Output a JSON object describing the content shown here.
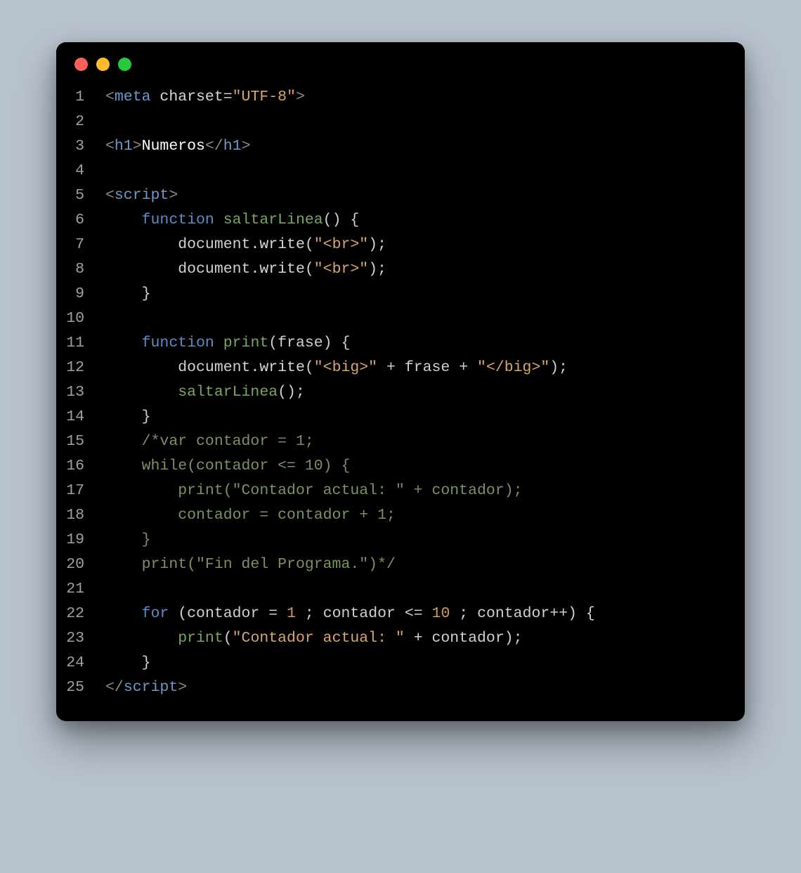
{
  "window": {
    "traffic_lights": [
      "close",
      "minimize",
      "maximize"
    ]
  },
  "colors": {
    "background_page": "#b9c3cf",
    "window_bg": "#000000",
    "red": "#ff5f56",
    "yellow": "#ffbd2e",
    "green": "#27c93f"
  },
  "syntax_colors": {
    "angle_bracket": "#8a8a8a",
    "tag": "#6b9acb",
    "attribute": "#d6d6d6",
    "string": "#d8a768",
    "text": "#ffffff",
    "keyword": "#5b8cc5",
    "function": "#7aa65f",
    "identifier": "#d0d0d0",
    "punctuation": "#d0d0d0",
    "number": "#d19a5e",
    "comment": "#7a9260"
  },
  "code": {
    "lines": [
      {
        "n": 1,
        "tokens": [
          [
            "angle",
            "<"
          ],
          [
            "tag",
            "meta"
          ],
          [
            "text",
            " "
          ],
          [
            "attr",
            "charset"
          ],
          [
            "punc",
            "="
          ],
          [
            "string",
            "\"UTF-8\""
          ],
          [
            "angle",
            ">"
          ]
        ]
      },
      {
        "n": 2,
        "tokens": []
      },
      {
        "n": 3,
        "tokens": [
          [
            "angle",
            "<"
          ],
          [
            "tag",
            "h1"
          ],
          [
            "angle",
            ">"
          ],
          [
            "txt",
            "Numeros"
          ],
          [
            "angle",
            "</"
          ],
          [
            "tag",
            "h1"
          ],
          [
            "angle",
            ">"
          ]
        ]
      },
      {
        "n": 4,
        "tokens": []
      },
      {
        "n": 5,
        "tokens": [
          [
            "angle",
            "<"
          ],
          [
            "tag",
            "script"
          ],
          [
            "angle",
            ">"
          ]
        ]
      },
      {
        "n": 6,
        "tokens": [
          [
            "ws",
            "    "
          ],
          [
            "keyword",
            "function"
          ],
          [
            "text",
            " "
          ],
          [
            "fn",
            "saltarLinea"
          ],
          [
            "punc",
            "()"
          ],
          [
            "text",
            " "
          ],
          [
            "punc",
            "{"
          ]
        ]
      },
      {
        "n": 7,
        "tokens": [
          [
            "ws",
            "        "
          ],
          [
            "ident",
            "document"
          ],
          [
            "punc",
            "."
          ],
          [
            "method",
            "write"
          ],
          [
            "punc",
            "("
          ],
          [
            "string",
            "\"<br>\""
          ],
          [
            "punc",
            ");"
          ]
        ]
      },
      {
        "n": 8,
        "tokens": [
          [
            "ws",
            "        "
          ],
          [
            "ident",
            "document"
          ],
          [
            "punc",
            "."
          ],
          [
            "method",
            "write"
          ],
          [
            "punc",
            "("
          ],
          [
            "string",
            "\"<br>\""
          ],
          [
            "punc",
            ");"
          ]
        ]
      },
      {
        "n": 9,
        "tokens": [
          [
            "ws",
            "    "
          ],
          [
            "punc",
            "}"
          ]
        ]
      },
      {
        "n": 10,
        "tokens": []
      },
      {
        "n": 11,
        "tokens": [
          [
            "ws",
            "    "
          ],
          [
            "keyword",
            "function"
          ],
          [
            "text",
            " "
          ],
          [
            "fn",
            "print"
          ],
          [
            "punc",
            "("
          ],
          [
            "ident",
            "frase"
          ],
          [
            "punc",
            ")"
          ],
          [
            "text",
            " "
          ],
          [
            "punc",
            "{"
          ]
        ]
      },
      {
        "n": 12,
        "tokens": [
          [
            "ws",
            "        "
          ],
          [
            "ident",
            "document"
          ],
          [
            "punc",
            "."
          ],
          [
            "method",
            "write"
          ],
          [
            "punc",
            "("
          ],
          [
            "string",
            "\"<big>\""
          ],
          [
            "text",
            " "
          ],
          [
            "punc",
            "+"
          ],
          [
            "text",
            " "
          ],
          [
            "ident",
            "frase"
          ],
          [
            "text",
            " "
          ],
          [
            "punc",
            "+"
          ],
          [
            "text",
            " "
          ],
          [
            "string",
            "\"</big>\""
          ],
          [
            "punc",
            ");"
          ]
        ]
      },
      {
        "n": 13,
        "tokens": [
          [
            "ws",
            "        "
          ],
          [
            "fn",
            "saltarLinea"
          ],
          [
            "punc",
            "();"
          ]
        ]
      },
      {
        "n": 14,
        "tokens": [
          [
            "ws",
            "    "
          ],
          [
            "punc",
            "}"
          ]
        ]
      },
      {
        "n": 15,
        "tokens": [
          [
            "ws",
            "    "
          ],
          [
            "comment",
            "/*var contador = 1;"
          ]
        ]
      },
      {
        "n": 16,
        "tokens": [
          [
            "ws",
            "    "
          ],
          [
            "comment",
            "while(contador <= 10) {"
          ]
        ]
      },
      {
        "n": 17,
        "tokens": [
          [
            "ws",
            "        "
          ],
          [
            "comment",
            "print(\"Contador actual: \" + contador);"
          ]
        ]
      },
      {
        "n": 18,
        "tokens": [
          [
            "ws",
            "        "
          ],
          [
            "comment",
            "contador = contador + 1;"
          ]
        ]
      },
      {
        "n": 19,
        "tokens": [
          [
            "ws",
            "    "
          ],
          [
            "comment",
            "}"
          ]
        ]
      },
      {
        "n": 20,
        "tokens": [
          [
            "ws",
            "    "
          ],
          [
            "comment",
            "print(\"Fin del Programa.\")*/"
          ]
        ]
      },
      {
        "n": 21,
        "tokens": []
      },
      {
        "n": 22,
        "tokens": [
          [
            "ws",
            "    "
          ],
          [
            "keyword",
            "for"
          ],
          [
            "text",
            " "
          ],
          [
            "punc",
            "("
          ],
          [
            "ident",
            "contador"
          ],
          [
            "text",
            " "
          ],
          [
            "punc",
            "="
          ],
          [
            "text",
            " "
          ],
          [
            "num",
            "1"
          ],
          [
            "text",
            " "
          ],
          [
            "punc",
            ";"
          ],
          [
            "text",
            " "
          ],
          [
            "ident",
            "contador"
          ],
          [
            "text",
            " "
          ],
          [
            "punc",
            "<="
          ],
          [
            "text",
            " "
          ],
          [
            "num",
            "10"
          ],
          [
            "text",
            " "
          ],
          [
            "punc",
            ";"
          ],
          [
            "text",
            " "
          ],
          [
            "ident",
            "contador"
          ],
          [
            "punc",
            "++)"
          ],
          [
            "text",
            " "
          ],
          [
            "punc",
            "{"
          ]
        ]
      },
      {
        "n": 23,
        "tokens": [
          [
            "ws",
            "        "
          ],
          [
            "fn",
            "print"
          ],
          [
            "punc",
            "("
          ],
          [
            "string",
            "\"Contador actual: \""
          ],
          [
            "text",
            " "
          ],
          [
            "punc",
            "+"
          ],
          [
            "text",
            " "
          ],
          [
            "ident",
            "contador"
          ],
          [
            "punc",
            ");"
          ]
        ]
      },
      {
        "n": 24,
        "tokens": [
          [
            "ws",
            "    "
          ],
          [
            "punc",
            "}"
          ]
        ]
      },
      {
        "n": 25,
        "tokens": [
          [
            "angle",
            "</"
          ],
          [
            "tag",
            "script"
          ],
          [
            "angle",
            ">"
          ]
        ]
      }
    ]
  }
}
